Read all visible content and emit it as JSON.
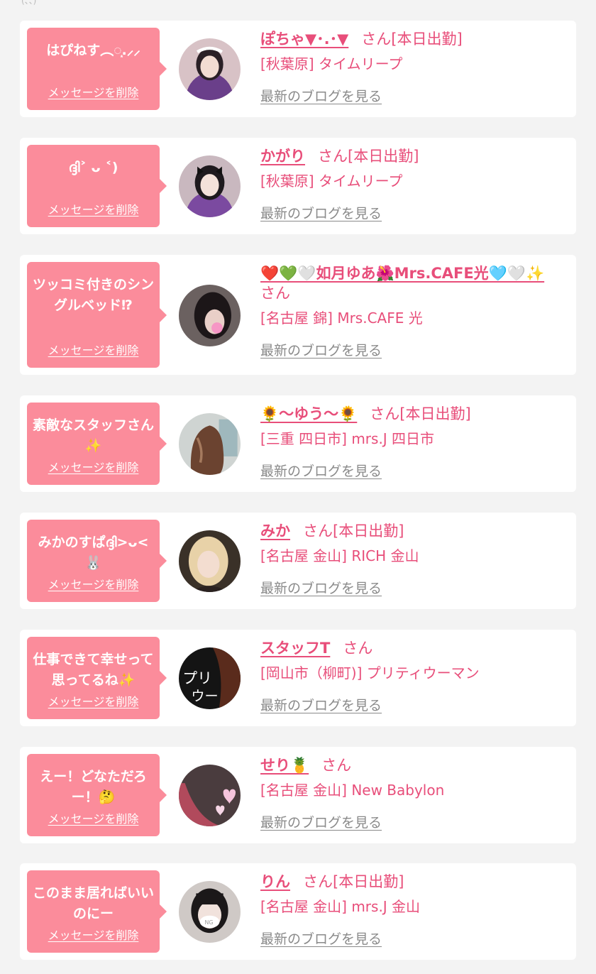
{
  "top_fragment": "(、、)",
  "delete_label": "メッセージを削除",
  "blog_label": "最新のブログを見る",
  "colors": {
    "bubble": "#fb8c9b",
    "name": "#e84e7a",
    "link_gray": "#8a8a8a",
    "background": "#f3f3f3"
  },
  "messages": [
    {
      "bubble": "はぴねす︵◌͙.⸝⸝",
      "name": "ぽちゃ▼･.･▼",
      "honorific": "さん[本日出勤]",
      "shop": "[秋葉原] タイムリープ",
      "avatar": "photo-girl-maid-headdress"
    },
    {
      "bubble": "ദ്ദി˃ ᴗ ˂)",
      "name": "かがり",
      "honorific": "さん[本日出勤]",
      "shop": "[秋葉原] タイムリープ",
      "avatar": "photo-girl-black-bow"
    },
    {
      "bubble": "ツッコミ付きのシングルベッド⁉︎",
      "name": "❤️💚🤍如月ゆあ🌺Mrs.CAFE光🩵🤍✨",
      "honorific": "さん",
      "shop": "[名古屋 錦] Mrs.CAFE 光",
      "avatar": "photo-girl-dark-hair"
    },
    {
      "bubble": "素敵なスタッフさん✨",
      "name": "🌻〜ゆう〜🌻",
      "honorific": "さん[本日出勤]",
      "shop": "[三重 四日市] mrs.J 四日市",
      "avatar": "photo-girl-braided-hair"
    },
    {
      "bubble": "みかのすぱദ്ദി>ᴗ<🐰",
      "name": "みか",
      "honorific": "さん[本日出勤]",
      "shop": "[名古屋 金山] RICH 金山",
      "avatar": "photo-girl-blonde"
    },
    {
      "bubble": "仕事できて幸せって思ってるね✨",
      "name": "スタッフT",
      "honorific": "さん",
      "shop": "[岡山市（柳町)] プリティウーマン",
      "avatar": "shop-logo-pretty-woman"
    },
    {
      "bubble": "えー！どなただろー！🤔",
      "name": "せり🍍",
      "honorific": "さん",
      "shop": "[名古屋 金山] New Babylon",
      "avatar": "photo-girl-pink-hearts"
    },
    {
      "bubble": "このまま居ればいいのにー",
      "name": "りん",
      "honorific": "さん[本日出勤]",
      "shop": "[名古屋 金山] mrs.J 金山",
      "avatar": "photo-girl-ng-mask"
    }
  ]
}
